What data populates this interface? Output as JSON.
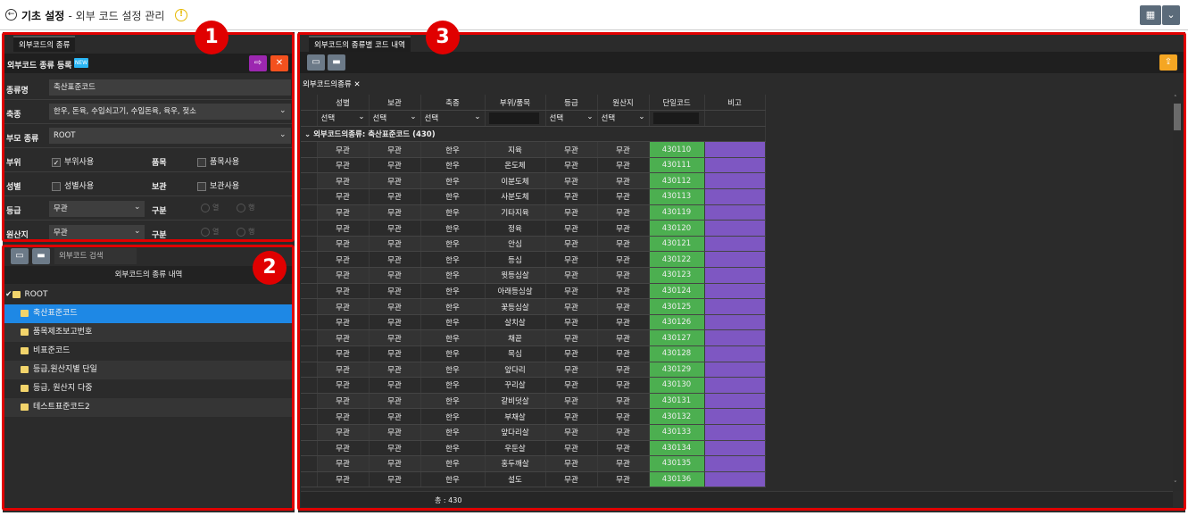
{
  "header": {
    "title": "기초 설정",
    "subtitle": "- 외부 코드 설정 관리",
    "back_icon": "arrow-left-circle-icon",
    "warn_icon": "exclamation-circle-icon",
    "warn_glyph": "!",
    "grid_btn": "▦",
    "dropdown_btn": "⌄"
  },
  "badges": {
    "one": "1",
    "two": "2",
    "three": "3"
  },
  "colors": {
    "highlight": "#e00000",
    "green": "#4caf50",
    "purple": "#7e57c2",
    "selected": "#1e88e5"
  },
  "panel1": {
    "tab": "외부코드의 종류",
    "section": "외부코드 종류 등록",
    "section_badge": "NEW",
    "btn_save": "⇨",
    "btn_delete": "✕",
    "fields": {
      "name_label": "종류명",
      "name_value": "축산표준코드",
      "species_label": "축종",
      "species_value": "한우, 돈육, 수입쇠고기, 수입돈육, 육우, 젖소",
      "parent_label": "부모 종류",
      "parent_value": "ROOT",
      "part_label": "부위",
      "part_check": "부위사용",
      "part_checked": true,
      "item_label": "품목",
      "item_check": "품목사용",
      "gender_label": "성별",
      "gender_check": "성별사용",
      "storage_label": "보관",
      "storage_check": "보관사용",
      "grade_label": "등급",
      "grade_value": "무관",
      "div_label": "구분",
      "radio_col": "열",
      "radio_row": "행",
      "origin_label": "원산지",
      "origin_value": "무관",
      "div2_label": "구분"
    }
  },
  "panel2": {
    "search_placeholder": "외부코드 검색",
    "list_title": "외부코드의 종류 내역",
    "root": "ROOT",
    "items": [
      "축산표준코드",
      "품목제조보고번호",
      "비표준코드",
      "등급,원산지별 단일",
      "등급, 원산지 다중",
      "테스트표준코드2"
    ]
  },
  "panel3": {
    "tab": "외부코드의 종류별 코드 내역",
    "upload_icon": "cloud-upload-icon",
    "filter_chip": "외부코드의종류",
    "filter_close": "✕",
    "columns": [
      "성별",
      "보관",
      "축종",
      "부위/품목",
      "등급",
      "원산지",
      "단일코드",
      "비고"
    ],
    "filter_select": "선택",
    "group_label": "외부코드의종류: 축산표준코드 (430)",
    "rows": [
      [
        "무관",
        "무관",
        "한우",
        "지육",
        "무관",
        "무관",
        "430110"
      ],
      [
        "무관",
        "무관",
        "한우",
        "온도체",
        "무관",
        "무관",
        "430111"
      ],
      [
        "무관",
        "무관",
        "한우",
        "이분도체",
        "무관",
        "무관",
        "430112"
      ],
      [
        "무관",
        "무관",
        "한우",
        "사분도체",
        "무관",
        "무관",
        "430113"
      ],
      [
        "무관",
        "무관",
        "한우",
        "기타지육",
        "무관",
        "무관",
        "430119"
      ],
      [
        "무관",
        "무관",
        "한우",
        "정육",
        "무관",
        "무관",
        "430120"
      ],
      [
        "무관",
        "무관",
        "한우",
        "안심",
        "무관",
        "무관",
        "430121"
      ],
      [
        "무관",
        "무관",
        "한우",
        "등심",
        "무관",
        "무관",
        "430122"
      ],
      [
        "무관",
        "무관",
        "한우",
        "윗등심살",
        "무관",
        "무관",
        "430123"
      ],
      [
        "무관",
        "무관",
        "한우",
        "아래등심살",
        "무관",
        "무관",
        "430124"
      ],
      [
        "무관",
        "무관",
        "한우",
        "꽃등심살",
        "무관",
        "무관",
        "430125"
      ],
      [
        "무관",
        "무관",
        "한우",
        "살치살",
        "무관",
        "무관",
        "430126"
      ],
      [
        "무관",
        "무관",
        "한우",
        "채끝",
        "무관",
        "무관",
        "430127"
      ],
      [
        "무관",
        "무관",
        "한우",
        "목심",
        "무관",
        "무관",
        "430128"
      ],
      [
        "무관",
        "무관",
        "한우",
        "앞다리",
        "무관",
        "무관",
        "430129"
      ],
      [
        "무관",
        "무관",
        "한우",
        "꾸리살",
        "무관",
        "무관",
        "430130"
      ],
      [
        "무관",
        "무관",
        "한우",
        "갈비덧살",
        "무관",
        "무관",
        "430131"
      ],
      [
        "무관",
        "무관",
        "한우",
        "부채살",
        "무관",
        "무관",
        "430132"
      ],
      [
        "무관",
        "무관",
        "한우",
        "앞다리살",
        "무관",
        "무관",
        "430133"
      ],
      [
        "무관",
        "무관",
        "한우",
        "우둔살",
        "무관",
        "무관",
        "430134"
      ],
      [
        "무관",
        "무관",
        "한우",
        "홍두깨살",
        "무관",
        "무관",
        "430135"
      ],
      [
        "무관",
        "무관",
        "한우",
        "설도",
        "무관",
        "무관",
        "430136"
      ]
    ],
    "footer": "총 : 430"
  }
}
